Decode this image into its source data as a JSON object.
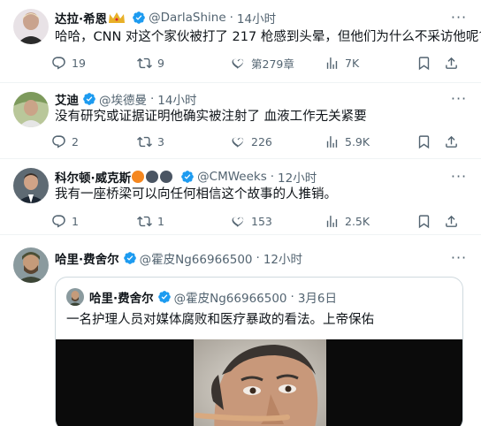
{
  "colors": {
    "accent": "#1d9bf0",
    "muted": "#536471",
    "text": "#0f1419",
    "gold": "#e8b028"
  },
  "icons": {
    "reply": "reply-icon",
    "retweet": "retweet-icon",
    "like": "heart-icon",
    "views": "views-icon",
    "bookmark": "bookmark-icon",
    "share": "share-icon",
    "more": "more-icon",
    "verified": "verified-icon"
  },
  "tweets": [
    {
      "name": "达拉·希恩",
      "handle": "@DarlaShine",
      "dot": "·",
      "time": "14小时",
      "text": "哈哈，CNN 对这个家伙被打了 217 枪感到头晕，但他们为什么不采访他呢?",
      "replies": "19",
      "retweets": "9",
      "likes": "第279章",
      "views": "7K"
    },
    {
      "name": "艾迪",
      "handle": "@埃德曼",
      "dot": "·",
      "time": "14小时",
      "text": "没有研究或证据证明他确实被注射了 血液工作无关紧要",
      "replies": "2",
      "retweets": "3",
      "likes": "226",
      "views": "5.9K"
    },
    {
      "name": "科尔顿·威克斯",
      "handle": "@CMWeeks",
      "dot": "·",
      "time": "12小时",
      "text": "我有一座桥梁可以向任何相信这个故事的人推销。",
      "replies": "1",
      "retweets": "1",
      "likes": "153",
      "views": "2.5K"
    },
    {
      "name": "哈里·费舍尔",
      "handle": "@霍皮Ng66966500",
      "dot": "·",
      "time": "12小时"
    }
  ],
  "quote": {
    "name": "哈里·费舍尔",
    "handle": "@霍皮Ng66966500",
    "dot": "·",
    "date": "3月6日",
    "text": "一名护理人员对媒体腐败和医疗暴政的看法。上帝保佑"
  }
}
